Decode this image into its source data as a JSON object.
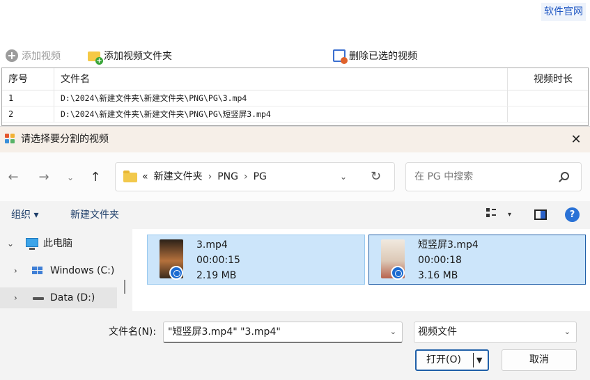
{
  "app": {
    "official_link": "软件官网",
    "toolbar": {
      "add_video": "添加视频",
      "add_folder": "添加视频文件夹",
      "delete_selected": "删除已选的视频"
    },
    "table": {
      "headers": [
        "序号",
        "文件名",
        "视频时长"
      ],
      "rows": [
        {
          "index": "1",
          "filename": "D:\\2024\\新建文件夹\\新建文件夹\\PNG\\PG\\3.mp4",
          "duration": ""
        },
        {
          "index": "2",
          "filename": "D:\\2024\\新建文件夹\\新建文件夹\\PNG\\PG\\短竖屏3.mp4",
          "duration": ""
        }
      ]
    }
  },
  "dialog": {
    "title": "请选择要分割的视频",
    "close_glyph": "✕",
    "nav": {
      "back": "←",
      "forward": "→",
      "recent": "⌄",
      "up": "↑"
    },
    "address": {
      "overflow": "«",
      "crumbs": [
        "新建文件夹",
        "PNG",
        "PG"
      ],
      "separator": "›",
      "dropdown": "⌄",
      "refresh": "↻"
    },
    "search_placeholder": "在 PG 中搜索",
    "commands": {
      "organize": "组织 ▾",
      "new_folder": "新建文件夹",
      "view_caret": "▾",
      "help": "?"
    },
    "tree": [
      {
        "label": "此电脑",
        "arrow": "⌄"
      },
      {
        "label": "Windows (C:)",
        "arrow": "›"
      },
      {
        "label": "Data (D:)",
        "arrow": "›"
      }
    ],
    "files": [
      {
        "name": "3.mp4",
        "duration": "00:00:15",
        "size": "2.19 MB"
      },
      {
        "name": "短竖屏3.mp4",
        "duration": "00:00:18",
        "size": "3.16 MB"
      }
    ],
    "filename_label": "文件名(N):",
    "filename_value": "\"短竖屏3.mp4\" \"3.mp4\"",
    "filetype_value": "视频文件",
    "open_label": "打开(O)",
    "cancel_label": "取消",
    "dropdown_chevron": "⌄",
    "split_arrow": "▼"
  },
  "colors": {
    "accent": "#1f5fa8",
    "selection": "#cce5fa",
    "title_bar": "#f6efe8",
    "link": "#1f57c3"
  }
}
